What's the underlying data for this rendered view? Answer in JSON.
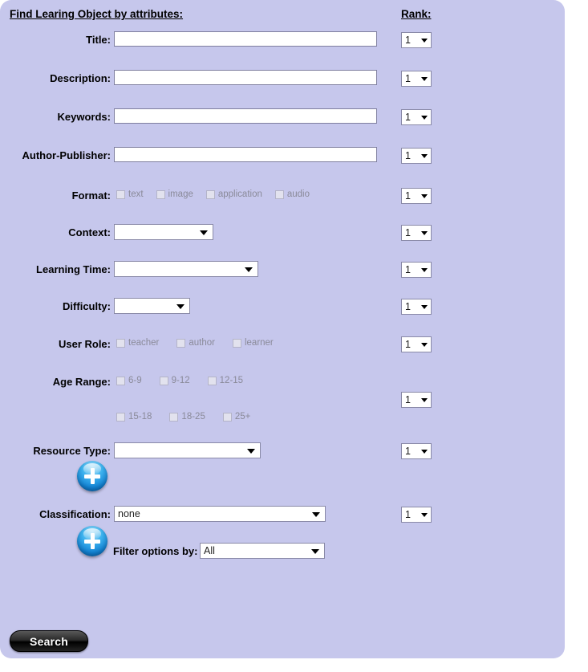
{
  "header": {
    "title": "Find Learing Object by attributes:",
    "rank_title": "Rank:"
  },
  "rank_value": "1",
  "fields": {
    "title": {
      "label": "Title:",
      "value": "",
      "placeholder": ""
    },
    "description": {
      "label": "Description:",
      "value": "",
      "placeholder": ""
    },
    "keywords": {
      "label": "Keywords:",
      "value": "",
      "placeholder": ""
    },
    "author_publisher": {
      "label": "Author-Publisher:",
      "value": "",
      "placeholder": ""
    },
    "format": {
      "label": "Format:",
      "options": [
        "text",
        "image",
        "application",
        "audio"
      ]
    },
    "context": {
      "label": "Context:",
      "value": ""
    },
    "learning_time": {
      "label": "Learning Time:",
      "value": ""
    },
    "difficulty": {
      "label": "Difficulty:",
      "value": ""
    },
    "user_role": {
      "label": "User Role:",
      "options": [
        "teacher",
        "author",
        "learner"
      ]
    },
    "age_range": {
      "label": "Age Range:",
      "options_row1": [
        "6-9",
        "9-12",
        "12-15"
      ],
      "options_row2": [
        "15-18",
        "18-25",
        "25+"
      ]
    },
    "resource_type": {
      "label": "Resource Type:",
      "value": ""
    },
    "classification": {
      "label": "Classification:",
      "value": "none"
    },
    "filter_options": {
      "label": "Filter options by:",
      "value": "All"
    }
  },
  "buttons": {
    "search": "Search",
    "add_resource_type": "+",
    "add_classification": "+"
  },
  "colors": {
    "panel_bg": "#c6c7ec",
    "plus_blue": "#1283d6",
    "search_black": "#000000"
  }
}
